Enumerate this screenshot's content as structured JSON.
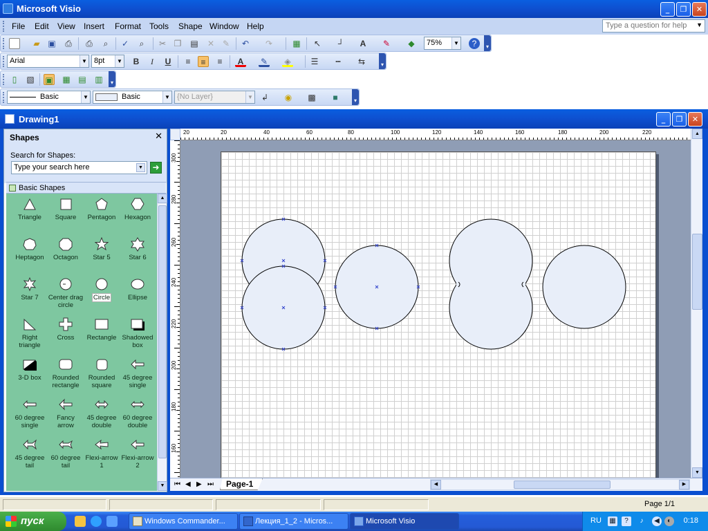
{
  "app": {
    "title": "Microsoft Visio",
    "window_controls": {
      "minimize": "_",
      "restore": "❐",
      "close": "✕"
    }
  },
  "menu": {
    "items": [
      "File",
      "Edit",
      "View",
      "Insert",
      "Format",
      "Tools",
      "Shape",
      "Window",
      "Help"
    ],
    "help_placeholder": "Type a question for help"
  },
  "toolbar_standard": {
    "zoom": "75%"
  },
  "toolbar_format": {
    "font": "Arial",
    "size": "8pt",
    "bold": "B",
    "italic": "I",
    "underline": "U"
  },
  "toolbar_line": {
    "line_style": "Basic",
    "fill_style": "Basic",
    "layer": "{No Layer}"
  },
  "document": {
    "title": "Drawing1"
  },
  "shapes_pane": {
    "title": "Shapes",
    "close": "✕",
    "search_label": "Search for Shapes:",
    "search_placeholder": "Type your search here",
    "stencil": "Basic Shapes",
    "items": [
      {
        "label": "Triangle",
        "icon": "triangle-icon"
      },
      {
        "label": "Square",
        "icon": "square-icon"
      },
      {
        "label": "Pentagon",
        "icon": "pentagon-icon"
      },
      {
        "label": "Hexagon",
        "icon": "hexagon-icon"
      },
      {
        "label": "Heptagon",
        "icon": "heptagon-icon"
      },
      {
        "label": "Octagon",
        "icon": "octagon-icon"
      },
      {
        "label": "Star 5",
        "icon": "star5-icon"
      },
      {
        "label": "Star 6",
        "icon": "star6-icon"
      },
      {
        "label": "Star 7",
        "icon": "star7-icon"
      },
      {
        "label": "Center drag circle",
        "icon": "center-drag-circle-icon"
      },
      {
        "label": "Circle",
        "icon": "circle-icon",
        "selected": true
      },
      {
        "label": "Ellipse",
        "icon": "ellipse-icon"
      },
      {
        "label": "Right triangle",
        "icon": "right-triangle-icon"
      },
      {
        "label": "Cross",
        "icon": "cross-icon"
      },
      {
        "label": "Rectangle",
        "icon": "rectangle-icon"
      },
      {
        "label": "Shadowed box",
        "icon": "shadowed-box-icon"
      },
      {
        "label": "3-D box",
        "icon": "3d-box-icon"
      },
      {
        "label": "Rounded rectangle",
        "icon": "rounded-rectangle-icon"
      },
      {
        "label": "Rounded square",
        "icon": "rounded-square-icon"
      },
      {
        "label": "45 degree single",
        "icon": "arrow-45-single-icon"
      },
      {
        "label": "60 degree single",
        "icon": "arrow-60-single-icon"
      },
      {
        "label": "Fancy arrow",
        "icon": "fancy-arrow-icon"
      },
      {
        "label": "45 degree double",
        "icon": "arrow-45-double-icon"
      },
      {
        "label": "60 degree double",
        "icon": "arrow-60-double-icon"
      },
      {
        "label": "45 degree tail",
        "icon": "arrow-45-tail-icon"
      },
      {
        "label": "60 degree tail",
        "icon": "arrow-60-tail-icon"
      },
      {
        "label": "Flexi-arrow 1",
        "icon": "flexi-arrow-1-icon"
      },
      {
        "label": "Flexi-arrow 2",
        "icon": "flexi-arrow-2-icon"
      }
    ]
  },
  "ruler": {
    "h_labels": [
      "20",
      "20",
      "40",
      "60",
      "80",
      "100",
      "120",
      "140",
      "160",
      "180",
      "200",
      "220"
    ],
    "v_labels": [
      "300",
      "280",
      "260",
      "240",
      "220",
      "200",
      "180",
      "160"
    ]
  },
  "page_tab": "Page-1",
  "status": {
    "page": "Page 1/1"
  },
  "taskbar": {
    "start": "пуск",
    "tasks": [
      "Windows Commander...",
      "Лекция_1_2 - Micros...",
      "Microsoft Visio"
    ],
    "lang": "RU",
    "clock": "0:18"
  }
}
